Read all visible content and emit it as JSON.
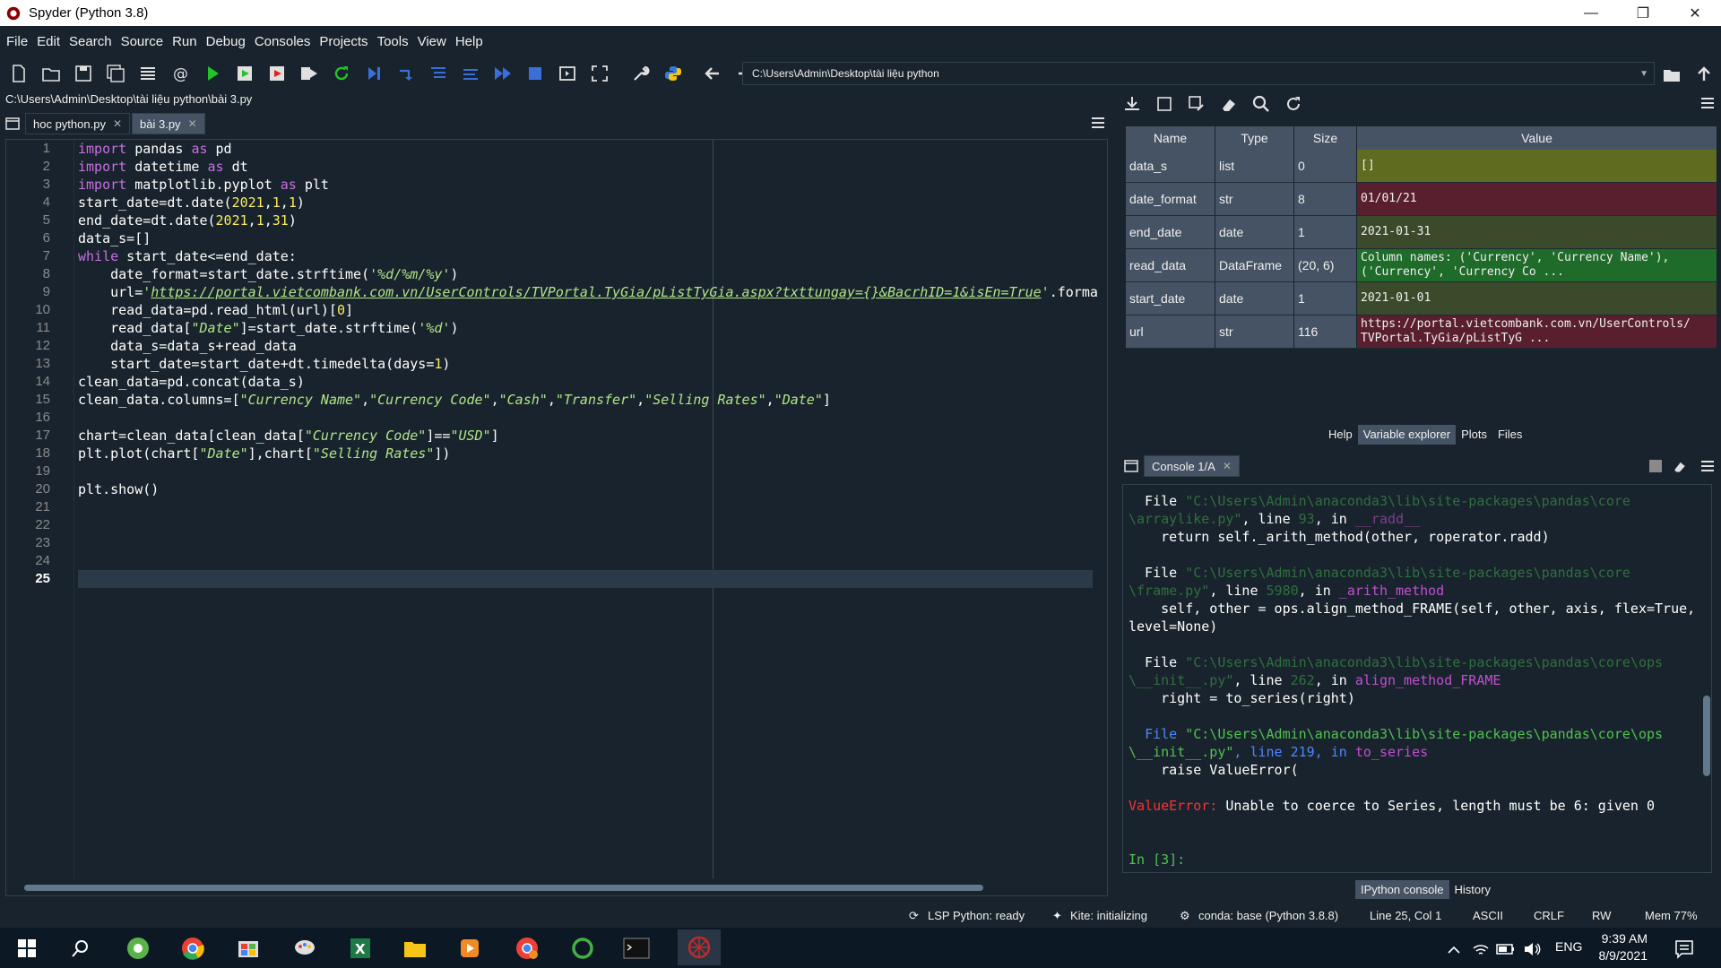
{
  "window": {
    "title": "Spyder (Python 3.8)"
  },
  "menu": [
    "File",
    "Edit",
    "Search",
    "Source",
    "Run",
    "Debug",
    "Consoles",
    "Projects",
    "Tools",
    "View",
    "Help"
  ],
  "toolbar": {
    "path": "C:\\Users\\Admin\\Desktop\\tài liệu python"
  },
  "editor": {
    "file_path": "C:\\Users\\Admin\\Desktop\\tài liệu python\\bài 3.py",
    "tabs": [
      {
        "label": "hoc python.py",
        "active": false
      },
      {
        "label": "bài 3.py",
        "active": true
      }
    ],
    "current_line": 25,
    "lines": [
      "import pandas as pd",
      "import datetime as dt",
      "import matplotlib.pyplot as plt",
      "start_date=dt.date(2021,1,1)",
      "end_date=dt.date(2021,1,31)",
      "data_s=[]",
      "while start_date<=end_date:",
      "    date_format=start_date.strftime('%d/%m/%y')",
      "    url='https://portal.vietcombank.com.vn/UserControls/TVPortal.TyGia/pListTyGia.aspx?txttungay={}&BacrhID=1&isEn=True'.forma",
      "    read_data=pd.read_html(url)[0]",
      "    read_data[\"Date\"]=start_date.strftime('%d')",
      "    data_s=data_s+read_data",
      "    start_date=start_date+dt.timedelta(days=1)",
      "clean_data=pd.concat(data_s)",
      "clean_data.columns=[\"Currency Name\",\"Currency Code\",\"Cash\",\"Transfer\",\"Selling Rates\",\"Date\"]",
      "",
      "chart=clean_data[clean_data[\"Currency Code\"]==\"USD\"]",
      "plt.plot(chart[\"Date\"],chart[\"Selling Rates\"])",
      "",
      "plt.show()",
      "",
      "",
      "",
      "",
      ""
    ]
  },
  "variable_explorer": {
    "headers": [
      "Name",
      "Type",
      "Size",
      "Value"
    ],
    "rows": [
      {
        "name": "data_s",
        "type": "list",
        "size": "0",
        "value": "[]",
        "color": "#5f6b1f"
      },
      {
        "name": "date_format",
        "type": "str",
        "size": "8",
        "value": "01/01/21",
        "color": "#5a1f2e"
      },
      {
        "name": "end_date",
        "type": "date",
        "size": "1",
        "value": "2021-01-31",
        "color": "#3a4a2a"
      },
      {
        "name": "read_data",
        "type": "DataFrame",
        "size": "(20, 6)",
        "value": "Column names: ('Currency', 'Currency Name'),\n('Currency', 'Currency Co ...",
        "color": "#1f6b2a"
      },
      {
        "name": "start_date",
        "type": "date",
        "size": "1",
        "value": "2021-01-01",
        "color": "#3a4a2a"
      },
      {
        "name": "url",
        "type": "str",
        "size": "116",
        "value": "https://portal.vietcombank.com.vn/UserControls/\nTVPortal.TyGia/pListTyG ...",
        "color": "#5a1f2e"
      }
    ],
    "tabs": [
      "Help",
      "Variable explorer",
      "Plots",
      "Files"
    ],
    "active_tab": "Variable explorer"
  },
  "console": {
    "tab": "Console 1/A",
    "bottom_tabs": [
      "IPython console",
      "History"
    ],
    "traceback": {
      "f1_path": "\"C:\\Users\\Admin\\anaconda3\\lib\\site-packages\\pandas\\core",
      "f1_path2": "\\arraylike.py\"",
      "f1_line": "93",
      "f1_func": "__radd__",
      "f1_code": "return self._arith_method(other, roperator.radd)",
      "f2_path": "\"C:\\Users\\Admin\\anaconda3\\lib\\site-packages\\pandas\\core",
      "f2_path2": "\\frame.py\"",
      "f2_line": "5980",
      "f2_func": "_arith_method",
      "f2_code": "self, other = ops.align_method_FRAME(self, other, axis, flex=True,",
      "f2_code2": "level=None)",
      "f3_path": "\"C:\\Users\\Admin\\anaconda3\\lib\\site-packages\\pandas\\core\\ops",
      "f3_path2": "\\__init__.py\"",
      "f3_line": "262",
      "f3_func": "align_method_FRAME",
      "f3_code": "right = to_series(right)",
      "f4_path": "\"C:\\Users\\Admin\\anaconda3\\lib\\site-packages\\pandas\\core\\ops",
      "f4_path2": "\\__init__.py\"",
      "f4_line": "219",
      "f4_func": "to_series",
      "f4_code": "raise ValueError(",
      "error_type": "ValueError:",
      "error_msg": "Unable to coerce to Series, length must be 6: given 0",
      "prompt": "In [3]:"
    }
  },
  "statusbar": {
    "lsp": "LSP Python: ready",
    "kite": "Kite: initializing",
    "conda": "conda: base (Python 3.8.8)",
    "position": "Line 25, Col 1",
    "encoding": "ASCII",
    "eol": "CRLF",
    "rw": "RW",
    "mem": "Mem 77%"
  },
  "taskbar": {
    "time": "9:39 AM",
    "date": "8/9/2021",
    "lang": "ENG"
  }
}
